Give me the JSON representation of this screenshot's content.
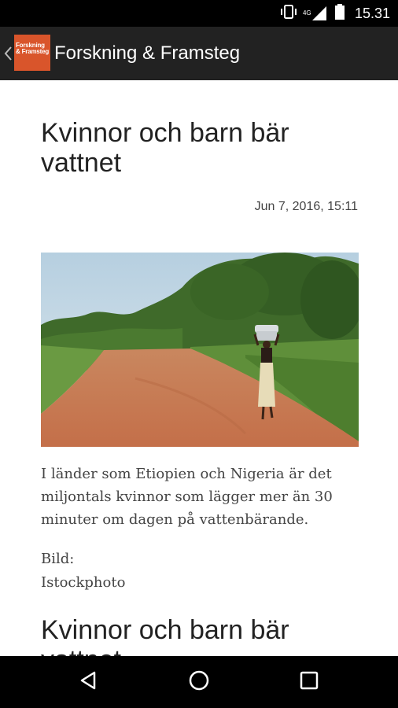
{
  "status_bar": {
    "time": "15.31",
    "network_type": "4G",
    "icons": [
      "vibrate-icon",
      "signal-icon",
      "battery-icon"
    ]
  },
  "app_bar": {
    "title": "Forskning & Framsteg",
    "logo_text": "Forskning & Framsteg",
    "logo_color": "#d9552b",
    "background": "#222222"
  },
  "article": {
    "title": "Kvinnor och barn bär vattnet",
    "date": "Jun 7, 2016, 15:11",
    "image_description": "Kvinna bär vattenkärl på huvudet längs en röd grusväg",
    "lead": "I länder som Etiopien och Nigeria är det miljontals kvinnor som lägger mer än 30 minuter om dagen på vattenbärande.",
    "credit_label": "Bild:",
    "credit_value": "Istockphoto",
    "repeated_title": "Kvinnor och barn bär vattnet"
  },
  "nav_bar": {
    "buttons": [
      "back-icon",
      "home-icon",
      "recents-icon"
    ]
  }
}
